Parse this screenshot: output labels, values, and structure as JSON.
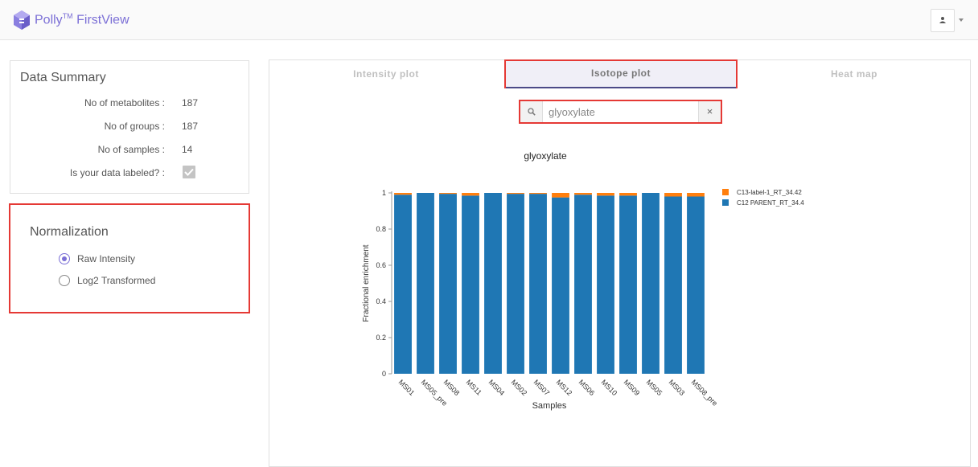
{
  "app": {
    "brand": "Polly",
    "brand_mark": "TM",
    "product": "FirstView"
  },
  "colors": {
    "accent": "#7b6fd6",
    "highlight": "#e53935",
    "series_c13": "#ff7f0e",
    "series_c12": "#1f77b4"
  },
  "data_summary": {
    "title": "Data Summary",
    "rows": [
      {
        "label": "No of metabolites :",
        "value": "187"
      },
      {
        "label": "No of groups :",
        "value": "187"
      },
      {
        "label": "No of samples :",
        "value": "14"
      }
    ],
    "labeled_question": "Is your data labeled? :",
    "labeled_checked": true
  },
  "normalization": {
    "title": "Normalization",
    "options": [
      {
        "label": "Raw Intensity",
        "selected": true
      },
      {
        "label": "Log2 Transformed",
        "selected": false
      }
    ]
  },
  "tabs": [
    {
      "label": "Intensity plot",
      "active": false
    },
    {
      "label": "Isotope plot",
      "active": true
    },
    {
      "label": "Heat map",
      "active": false
    }
  ],
  "search": {
    "value": "glyoxylate",
    "placeholder": "",
    "clear_label": "×"
  },
  "chart_data": {
    "type": "bar",
    "stacked": true,
    "title": "glyoxylate",
    "xlabel": "Samples",
    "ylabel": "Fractional enrichment",
    "ylim": [
      0,
      1
    ],
    "yticks": [
      0,
      0.2,
      0.4,
      0.6,
      0.8,
      1
    ],
    "legend_position": "top-right",
    "categories": [
      "MS01",
      "MS05_pre",
      "MS08",
      "MS11",
      "MS04",
      "MS02",
      "MS07",
      "MS12",
      "MS06",
      "MS10",
      "MS09",
      "MS05",
      "MS03",
      "MS08_pre"
    ],
    "series": [
      {
        "name": "C12 PARENT_RT_34.4",
        "color": "#1f77b4",
        "values": [
          0.99,
          1.0,
          0.995,
          0.985,
          1.0,
          0.995,
          0.995,
          0.975,
          0.99,
          0.985,
          0.985,
          1.0,
          0.98,
          0.98
        ]
      },
      {
        "name": "C13-label-1_RT_34.42",
        "color": "#ff7f0e",
        "values": [
          0.01,
          0.0,
          0.005,
          0.015,
          0.0,
          0.005,
          0.005,
          0.025,
          0.01,
          0.015,
          0.015,
          0.0,
          0.02,
          0.02
        ]
      }
    ],
    "legend": [
      "C13-label-1_RT_34.42",
      "C12 PARENT_RT_34.4"
    ]
  }
}
